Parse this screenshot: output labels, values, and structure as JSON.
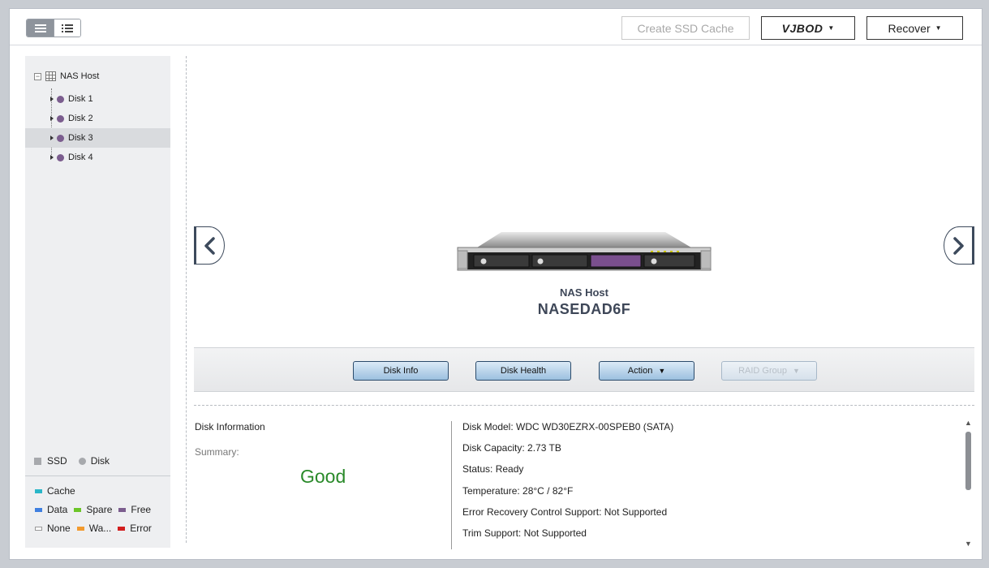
{
  "toolbar": {
    "view_buttons": [
      "list-view",
      "detail-view"
    ],
    "create_ssd_cache": "Create SSD Cache",
    "vjbod": "VJBOD",
    "recover": "Recover"
  },
  "tree": {
    "root": "NAS Host",
    "items": [
      {
        "label": "Disk 1",
        "selected": false
      },
      {
        "label": "Disk 2",
        "selected": false
      },
      {
        "label": "Disk 3",
        "selected": true
      },
      {
        "label": "Disk 4",
        "selected": false
      }
    ]
  },
  "legend": {
    "ssd": "SSD",
    "disk": "Disk",
    "cache": "Cache",
    "data": "Data",
    "spare": "Spare",
    "free": "Free",
    "none": "None",
    "warning": "Wa...",
    "error": "Error",
    "colors": {
      "cache": "#29b6c8",
      "data": "#3f7fe0",
      "spare": "#6cc528",
      "free": "#7b5d8e",
      "none": "#ffffff",
      "warning": "#f29a2e",
      "error": "#d21e1e"
    }
  },
  "host": {
    "label": "NAS Host",
    "name": "NASEDAD6F"
  },
  "actions": {
    "disk_info": "Disk Info",
    "disk_health": "Disk Health",
    "action": "Action",
    "raid_group": "RAID Group"
  },
  "info": {
    "title": "Disk Information",
    "summary_label": "Summary:",
    "summary_value": "Good",
    "details": [
      "Disk Model: WDC WD30EZRX-00SPEB0 (SATA)",
      "Disk Capacity: 2.73 TB",
      "Status: Ready",
      "Temperature: 28°C / 82°F",
      "Error Recovery Control Support: Not Supported",
      "Trim Support: Not Supported"
    ]
  }
}
